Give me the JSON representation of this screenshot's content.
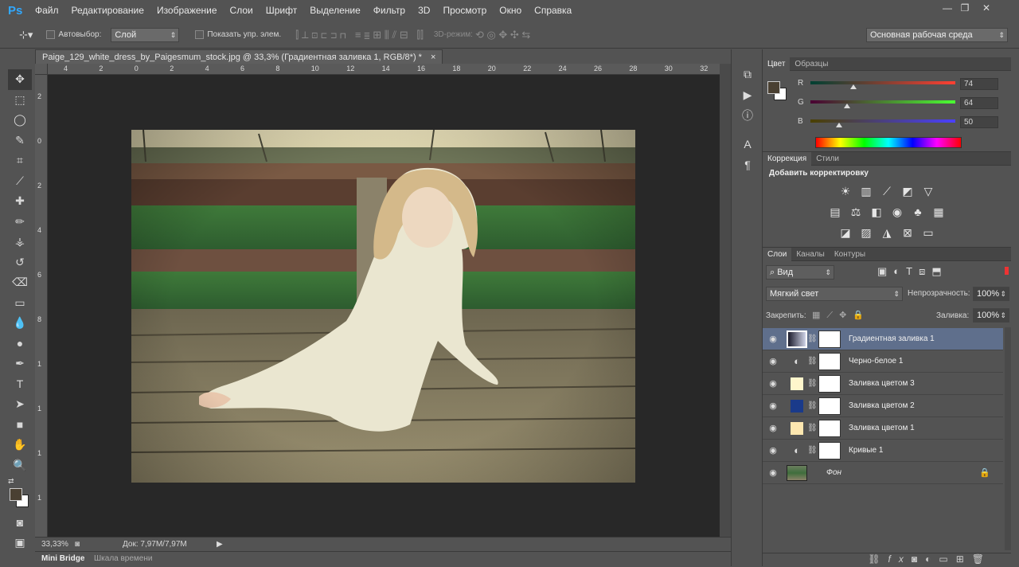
{
  "app": {
    "logo": "Ps"
  },
  "menu": [
    "Файл",
    "Редактирование",
    "Изображение",
    "Слои",
    "Шрифт",
    "Выделение",
    "Фильтр",
    "3D",
    "Просмотр",
    "Окно",
    "Справка"
  ],
  "window_controls": [
    "—",
    "❐",
    "✕"
  ],
  "options": {
    "autoselect_label": "Автовыбор:",
    "autoselect_value": "Слой",
    "show_controls_label": "Показать упр. элем.",
    "mode3d_label": "3D-режим:",
    "workspace": "Основная рабочая среда"
  },
  "document": {
    "tab_title": "Paige_129_white_dress_by_Paigesmum_stock.jpg @ 33,3% (Градиентная заливка 1, RGB/8*) *",
    "tab_close": "×",
    "zoom": "33,33%",
    "doc_info": "Док: 7,97M/7,97M"
  },
  "ruler_h": [
    "4",
    "2",
    "0",
    "2",
    "4",
    "6",
    "8",
    "10",
    "12",
    "14",
    "16",
    "18",
    "20",
    "22",
    "24",
    "26",
    "28",
    "30",
    "32"
  ],
  "ruler_v": [
    "2",
    "0",
    "2",
    "4",
    "6",
    "8",
    "1",
    "1",
    "1",
    "1"
  ],
  "bottom_tabs": [
    "Mini Bridge",
    "Шкала времени"
  ],
  "color_panel": {
    "tabs": [
      "Цвет",
      "Образцы"
    ],
    "fg_color": "#4a4032",
    "bg_color": "#ffffff",
    "r": {
      "label": "R",
      "value": "74"
    },
    "g": {
      "label": "G",
      "value": "64"
    },
    "b": {
      "label": "B",
      "value": "50"
    }
  },
  "adjust_panel": {
    "tabs": [
      "Коррекция",
      "Стили"
    ],
    "heading": "Добавить корректировку"
  },
  "layers_panel": {
    "tabs": [
      "Слои",
      "Каналы",
      "Контуры"
    ],
    "filter_kind": "Вид",
    "blend_mode": "Мягкий свет",
    "opacity_label": "Непрозрачность:",
    "opacity_value": "100%",
    "lock_label": "Закрепить:",
    "fill_label": "Заливка:",
    "fill_value": "100%",
    "layers": [
      {
        "name": "Градиентная заливка 1",
        "thumb": "gradient",
        "selected": true
      },
      {
        "name": "Черно-белое 1",
        "thumb": "adjust"
      },
      {
        "name": "Заливка цветом 3",
        "thumb": "#fff6cc"
      },
      {
        "name": "Заливка цветом 2",
        "thumb": "#1a3a8a"
      },
      {
        "name": "Заливка цветом 1",
        "thumb": "#fde7b0"
      },
      {
        "name": "Кривые 1",
        "thumb": "adjust"
      },
      {
        "name": "Фон",
        "thumb": "photo",
        "locked": true
      }
    ],
    "footer_icons": [
      "link-icon",
      "fx-icon",
      "mask-icon",
      "adjustment-icon",
      "folder-icon",
      "new-layer-icon",
      "trash-icon"
    ]
  },
  "colors": {
    "accent": "#5f6f8c",
    "ui_bg": "#535353",
    "canvas_bg": "#282828"
  }
}
